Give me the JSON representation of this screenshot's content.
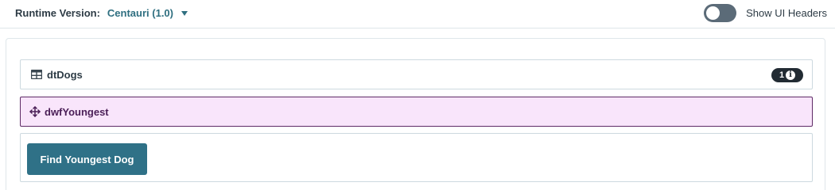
{
  "topbar": {
    "runtime_label": "Runtime Version:",
    "runtime_value": "Centauri (1.0)",
    "toggle_label": "Show UI Headers",
    "toggle_on": false
  },
  "panels": {
    "table": {
      "icon": "table-icon",
      "title": "dtDogs",
      "badge_count": "1",
      "badge_icon": "info-icon"
    },
    "dataflow": {
      "icon": "move-icon",
      "title": "dwfYoungest"
    },
    "action": {
      "button_label": "Find Youngest Dog"
    }
  },
  "colors": {
    "accent": "#2f6f80",
    "button": "#2f7187",
    "flow_background": "#f9e5fb",
    "flow_border": "#5e2a66",
    "badge": "#222b33"
  }
}
